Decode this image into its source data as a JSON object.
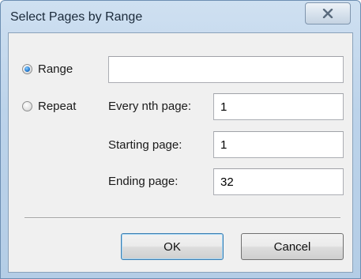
{
  "window": {
    "title": "Select Pages by Range"
  },
  "titlebar": {
    "close_icon": "close-x-icon"
  },
  "range": {
    "label": "Range",
    "checked": true,
    "value": ""
  },
  "repeat": {
    "label": "Repeat",
    "checked": false
  },
  "fields": {
    "every_nth_label": "Every nth page:",
    "every_nth_value": "1",
    "starting_label": "Starting page:",
    "starting_value": "1",
    "ending_label": "Ending page:",
    "ending_value": "32"
  },
  "buttons": {
    "ok": "OK",
    "cancel": "Cancel"
  }
}
